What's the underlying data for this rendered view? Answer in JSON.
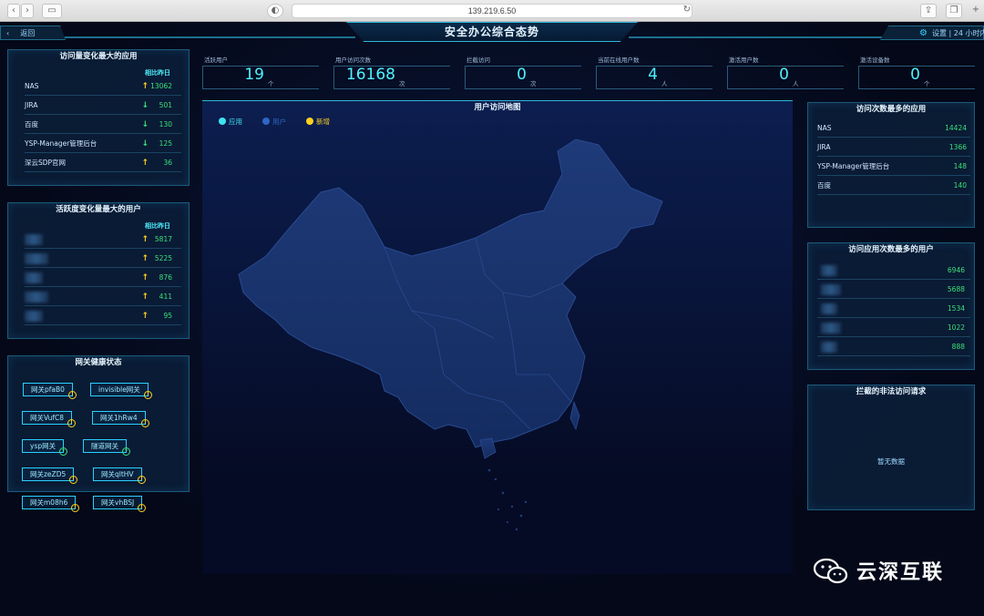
{
  "browser": {
    "url": "139.219.6.50"
  },
  "header": {
    "title": "安全办公综合态势",
    "back_label": "返回",
    "settings_label": "设置 | 24 小时内"
  },
  "stats": [
    {
      "label": "活跃用户",
      "value": "19",
      "unit": "个"
    },
    {
      "label": "用户访问次数",
      "value": "16168",
      "unit": "次"
    },
    {
      "label": "拦截访问",
      "value": "0",
      "unit": "次"
    },
    {
      "label": "当前在线用户数",
      "value": "4",
      "unit": "人"
    },
    {
      "label": "激活用户数",
      "value": "0",
      "unit": "人"
    },
    {
      "label": "激活设备数",
      "value": "0",
      "unit": "个"
    }
  ],
  "app_change": {
    "title": "访问量变化最大的应用",
    "compare_label": "相比昨日",
    "rows": [
      {
        "name": "NAS",
        "value": "13062",
        "trend": "up"
      },
      {
        "name": "JIRA",
        "value": "501",
        "trend": "down"
      },
      {
        "name": "百度",
        "value": "130",
        "trend": "down"
      },
      {
        "name": "YSP-Manager管理后台",
        "value": "125",
        "trend": "down"
      },
      {
        "name": "深云SDP官网",
        "value": "36",
        "trend": "up"
      }
    ]
  },
  "user_change": {
    "title": "活跃度变化量最大的用户",
    "compare_label": "相比昨日",
    "rows": [
      {
        "value": "5817",
        "trend": "up"
      },
      {
        "value": "5225",
        "trend": "up"
      },
      {
        "value": "876",
        "trend": "up"
      },
      {
        "value": "411",
        "trend": "up"
      },
      {
        "value": "95",
        "trend": "up"
      }
    ]
  },
  "gateway": {
    "title": "网关健康状态",
    "items": [
      {
        "name": "网关pfaB0",
        "status": "warn"
      },
      {
        "name": "invisible网关",
        "status": "warn"
      },
      {
        "name": "网关VufC8",
        "status": "warn"
      },
      {
        "name": "网关1hRw4",
        "status": "warn"
      },
      {
        "name": "ysp网关",
        "status": "ok"
      },
      {
        "name": "隧道网关",
        "status": "ok"
      },
      {
        "name": "网关zeZD5",
        "status": "warn"
      },
      {
        "name": "网关qltHV",
        "status": "warn"
      },
      {
        "name": "网关m08h6",
        "status": "warn"
      },
      {
        "name": "网关vhBSJ",
        "status": "warn"
      }
    ]
  },
  "map": {
    "title": "用户访问地图",
    "legend": [
      {
        "label": "应用",
        "color": "#3fe3f0"
      },
      {
        "label": "用户",
        "color": "#2f66c4"
      },
      {
        "label": "新增",
        "color": "#ffd21f"
      }
    ]
  },
  "top_apps": {
    "title": "访问次数最多的应用",
    "rows": [
      {
        "name": "NAS",
        "value": "14424"
      },
      {
        "name": "JIRA",
        "value": "1366"
      },
      {
        "name": "YSP-Manager管理后台",
        "value": "148"
      },
      {
        "name": "百度",
        "value": "140"
      }
    ]
  },
  "top_users": {
    "title": "访问应用次数最多的用户",
    "rows": [
      {
        "value": "6946"
      },
      {
        "value": "5688"
      },
      {
        "value": "1534"
      },
      {
        "value": "1022"
      },
      {
        "value": "888"
      }
    ]
  },
  "blocked": {
    "title": "拦截的非法访问请求",
    "empty": "暂无数据"
  },
  "watermark": {
    "text": "云深互联"
  },
  "colors": {
    "accent": "#2fb6d6",
    "up": "#ffd21f",
    "value": "#3be07a",
    "stat": "#4ff2ff"
  }
}
